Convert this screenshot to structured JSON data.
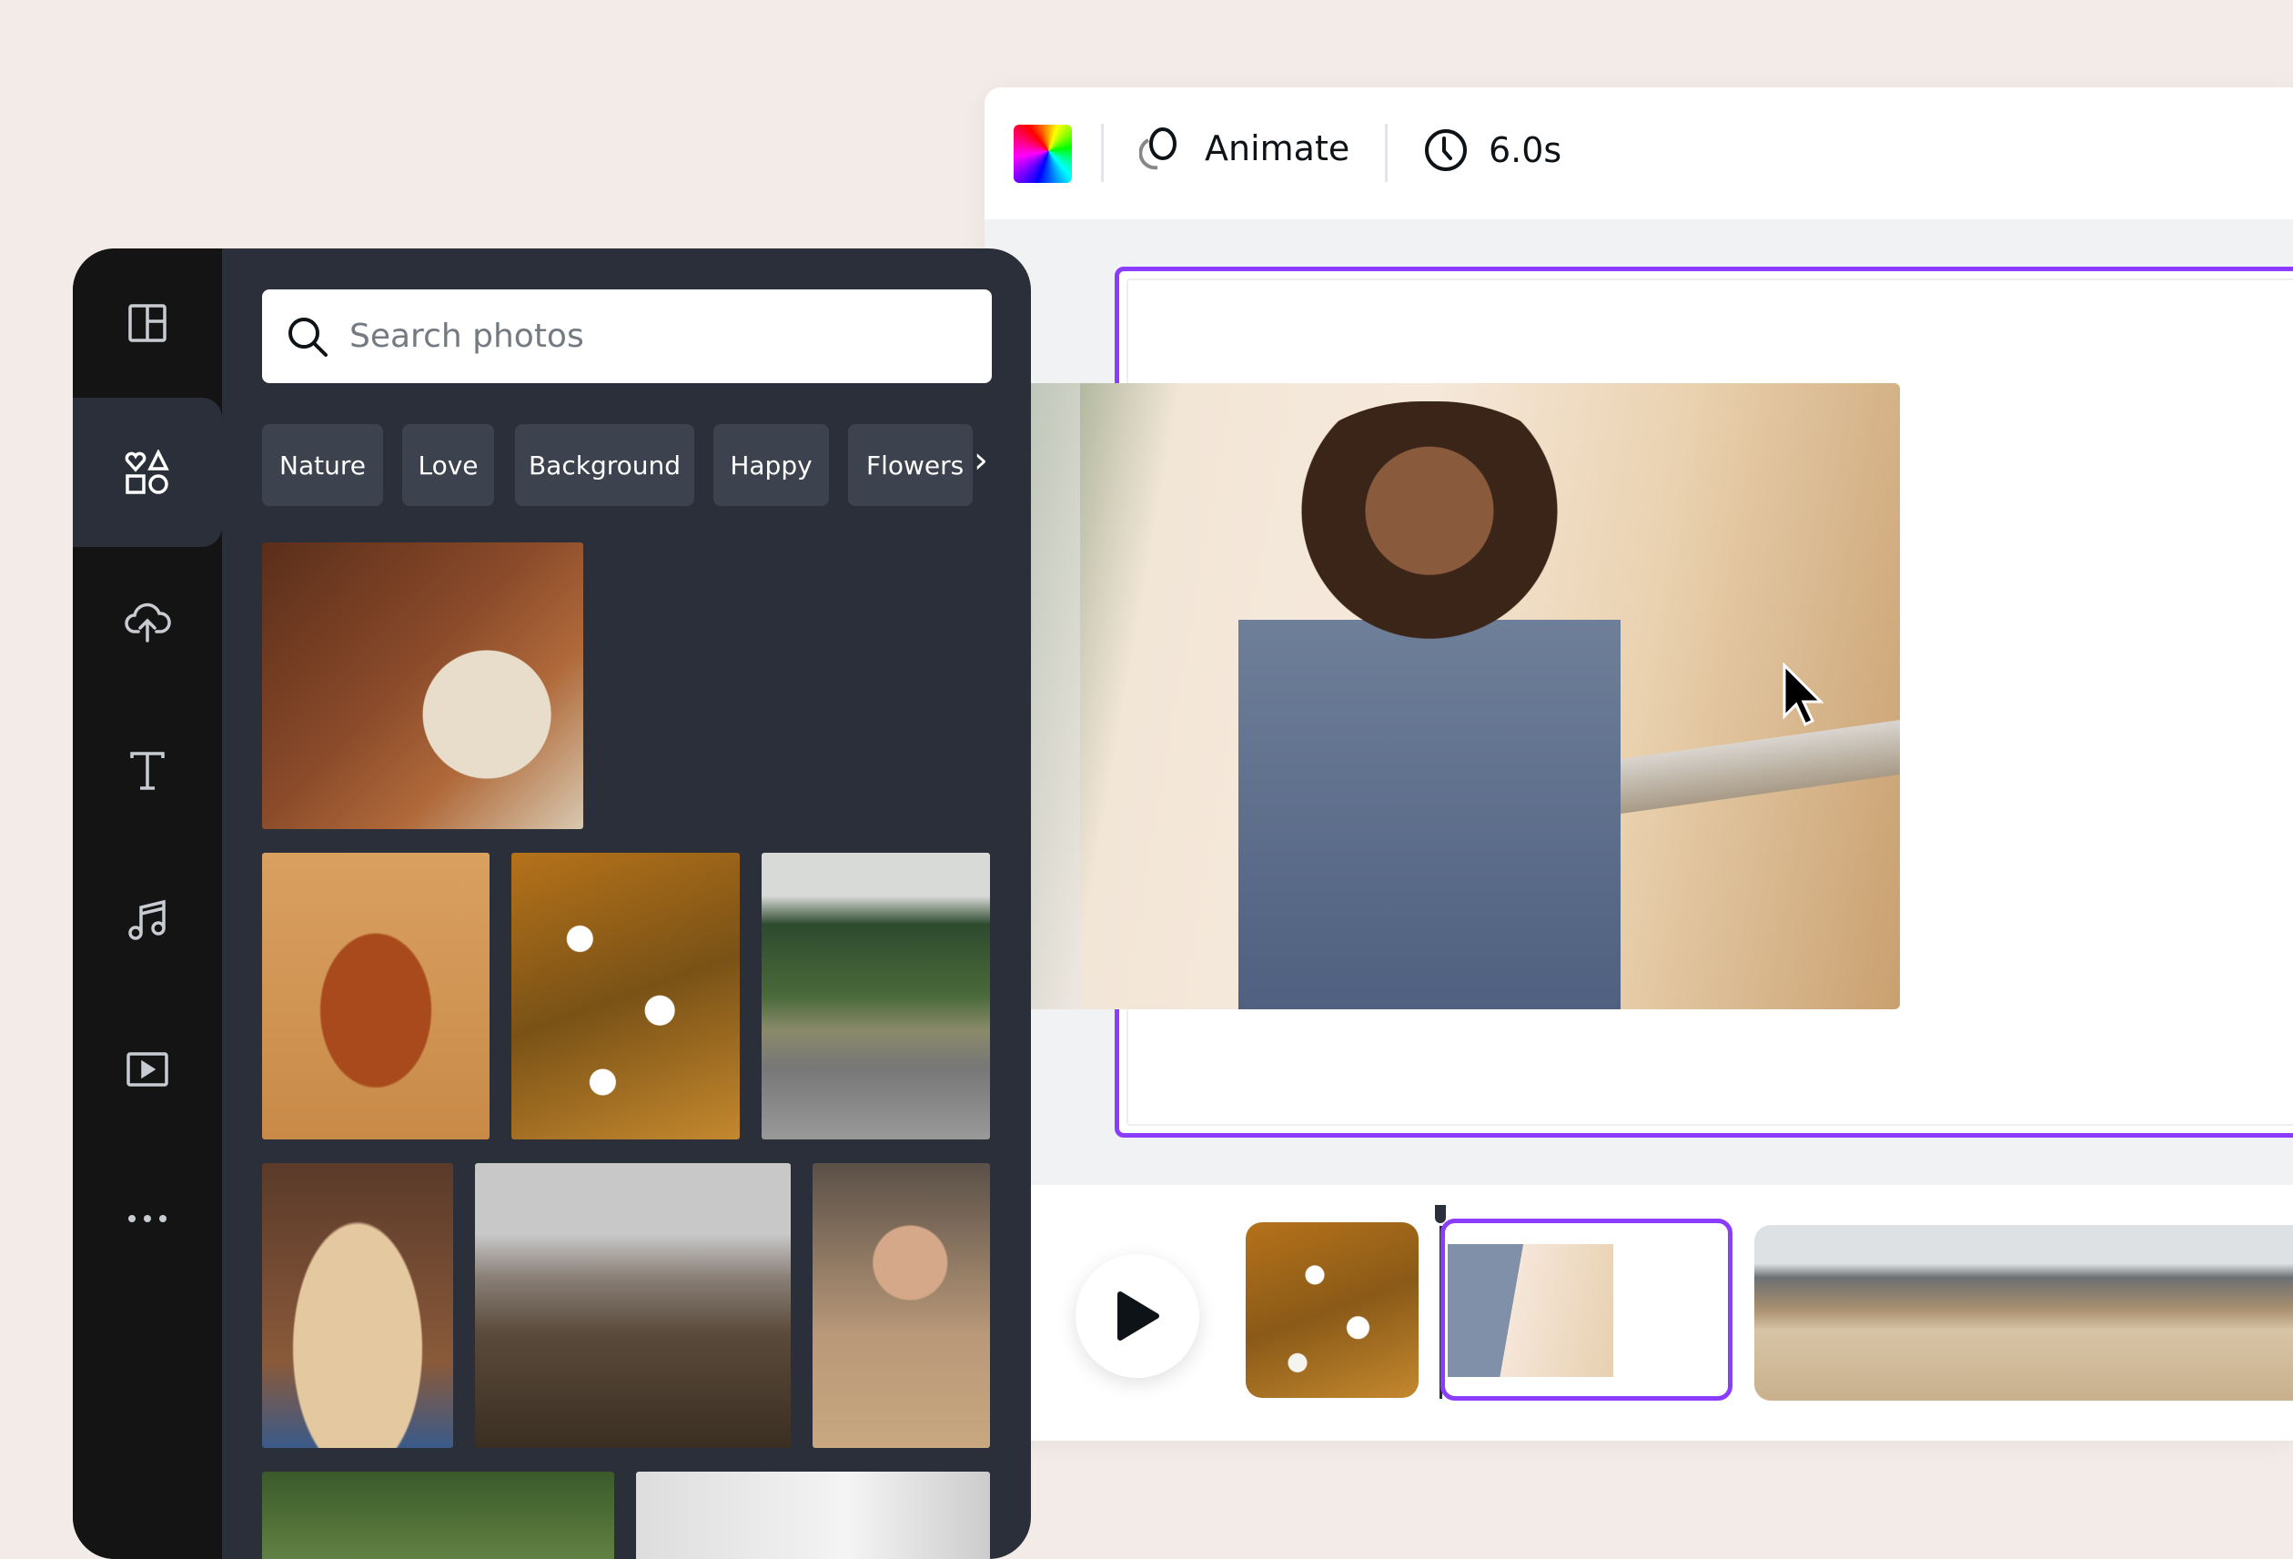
{
  "toolbar": {
    "color_icon": "color-palette-icon",
    "animate_label": "Animate",
    "duration": "6.0s"
  },
  "sidebar": {
    "items": [
      {
        "name": "design",
        "icon": "layout-icon"
      },
      {
        "name": "elements",
        "icon": "shapes-icon",
        "active": true
      },
      {
        "name": "uploads",
        "icon": "cloud-upload-icon"
      },
      {
        "name": "text",
        "icon": "text-icon"
      },
      {
        "name": "audio",
        "icon": "music-note-icon"
      },
      {
        "name": "videos",
        "icon": "video-play-icon"
      },
      {
        "name": "more",
        "icon": "more-dots-icon"
      }
    ]
  },
  "search": {
    "placeholder": "Search photos",
    "value": ""
  },
  "chips": [
    "Nature",
    "Love",
    "Background",
    "Happy",
    "Flowers"
  ],
  "colors": {
    "accent": "#8b3dff",
    "panel": "#2a2f3a",
    "sidebar": "#141414",
    "chip": "#3d434e",
    "background": "#f3ebe7"
  },
  "timeline": {
    "clips": [
      "flowers",
      "woman-headphones",
      "mountains"
    ],
    "selected_clip": 1
  }
}
